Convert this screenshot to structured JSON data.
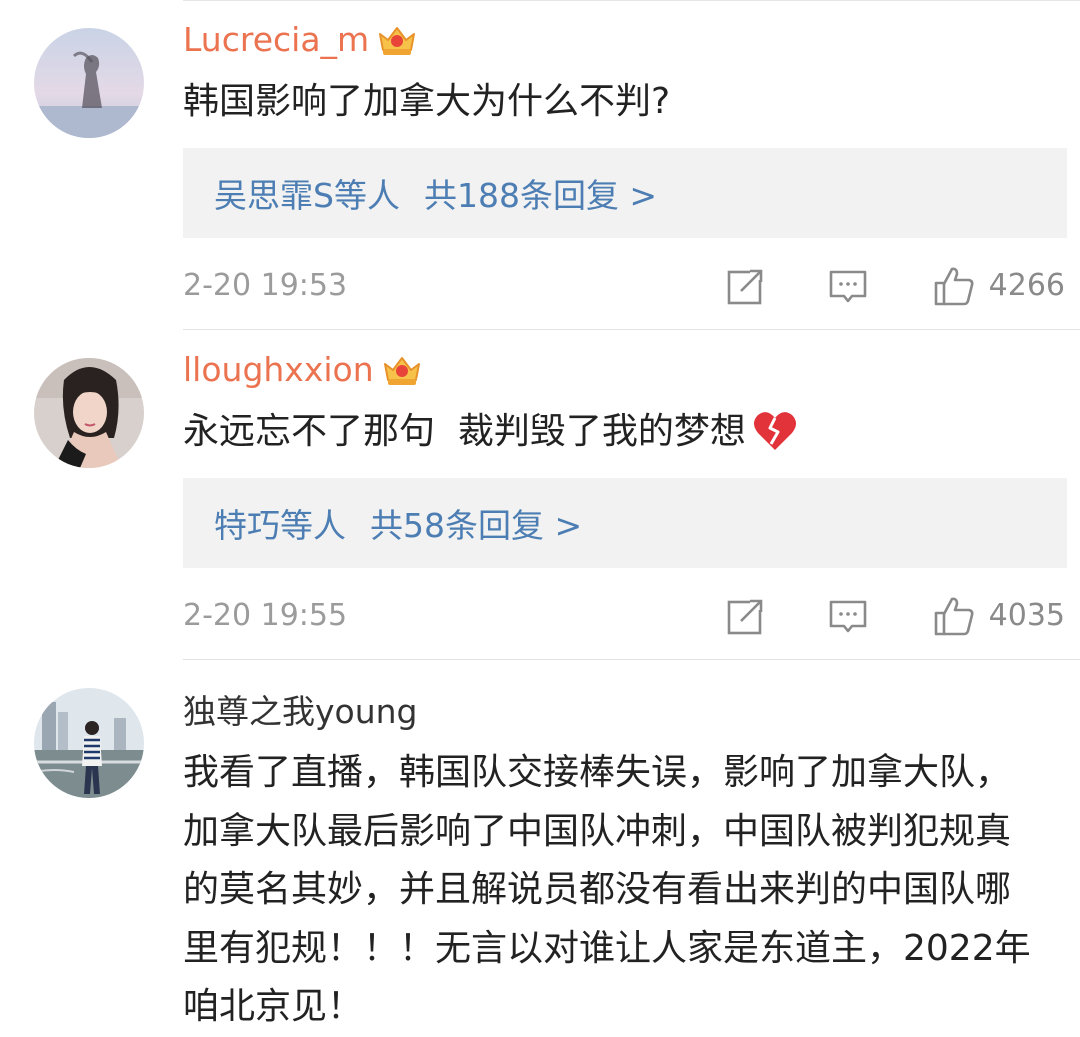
{
  "comments": [
    {
      "username": "Lucrecia_m",
      "vip_level": "4",
      "text": "韩国影响了加拿大为什么不判?",
      "replies": {
        "names": "吴思霏S等人",
        "count": "共188条回复 >"
      },
      "time": "2-20 19:53",
      "likes": "4266"
    },
    {
      "username": "lloughxxion",
      "vip_level": "2",
      "text": "永远忘不了那句  裁判毁了我的梦想",
      "emoji": "broken-heart-icon",
      "replies": {
        "names": "特巧等人",
        "count": "共58条回复 >"
      },
      "time": "2-20 19:55",
      "likes": "4035"
    },
    {
      "username": "独尊之我young",
      "text": "我看了直播，韩国队交接棒失误，影响了加拿大队，加拿大队最后影响了中国队冲刺，中国队被判犯规真的莫名其妙，并且解说员都没有看出来判的中国队哪里有犯规！！！无言以对谁让人家是东道主，2022年咱北京见！"
    }
  ],
  "colors": {
    "vip_name": "#eb7350",
    "link": "#4c7db3",
    "reply_bg": "#f2f2f2",
    "meta": "#9b9b9b"
  }
}
